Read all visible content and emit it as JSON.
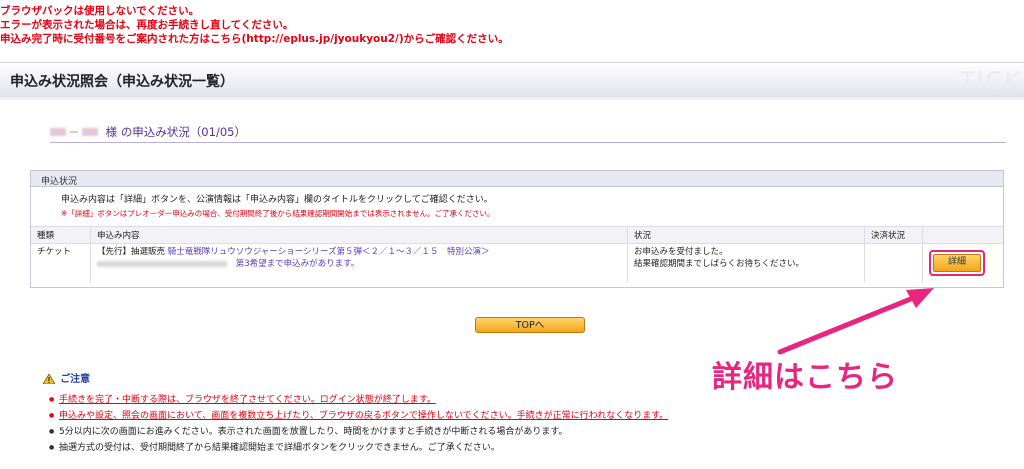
{
  "notice": {
    "line1": "ブラウザバックは使用しないでください。",
    "line2": "エラーが表示された場合は、再度お手続きし直してください。",
    "line3": "申込み完了時に受付番号をご案内された方はこちら(http://eplus.jp/jyoukyou2/)からご確認ください。"
  },
  "header": {
    "title": "申込み状況照会（申込み状況一覧）",
    "logo_text": "TICK"
  },
  "status_heading": {
    "honorific": "様",
    "label": "の申込み状況（01/05）"
  },
  "panel": {
    "title": "申込状況",
    "info": "申込み内容は「詳細」ボタンを、公演情報は「申込み内容」欄のタイトルをクリックしてご確認ください。",
    "note": "※「詳細」ボタンはプレオーダー申込みの場合、受付期間終了後から結果確認期間開始までは表示されません。ご了承ください。"
  },
  "table": {
    "headers": [
      "種類",
      "申込み内容",
      "状況",
      "決済状況"
    ],
    "rows": [
      {
        "kind": "チケット",
        "sale_type": "【先行】抽選販売",
        "title_link": "騎士竜戦隊リュウソウジャーショーシリーズ第５弾＜２／１〜３／１５　特別公演＞",
        "preference": "第3希望まで申込みがあります。",
        "status_line1": "お申込みを受付ました。",
        "status_line2": "結果確認期間までしばらくお待ちください。",
        "detail_label": "詳細"
      }
    ]
  },
  "top_button": "TOPへ",
  "annotation": "詳細はこちら",
  "caution": {
    "title": "ご注意",
    "items": [
      {
        "text": "手続きを完了・中断する際は、ブラウザを終了させてください。ログイン状態が終了します。",
        "style": "red"
      },
      {
        "text": "申込みや設定、照会の画面において、画面を複数立ち上げたり、ブラウザの戻るボタンで操作しないでください。手続きが正常に行われなくなります。",
        "style": "red"
      },
      {
        "text": "5分以内に次の画面にお進みください。表示された画面を放置したり、時間をかけますと手続きが中断される場合があります。",
        "style": "black"
      },
      {
        "text": "抽選方式の受付は、受付期間終了から結果確認開始まで詳細ボタンをクリックできません。ご了承ください。",
        "style": "black"
      }
    ]
  },
  "colors": {
    "alert_red": "#e60012",
    "highlight_pink": "#e8267f",
    "button_orange": "#f2a51c",
    "link_purple": "#5a3ebd"
  }
}
